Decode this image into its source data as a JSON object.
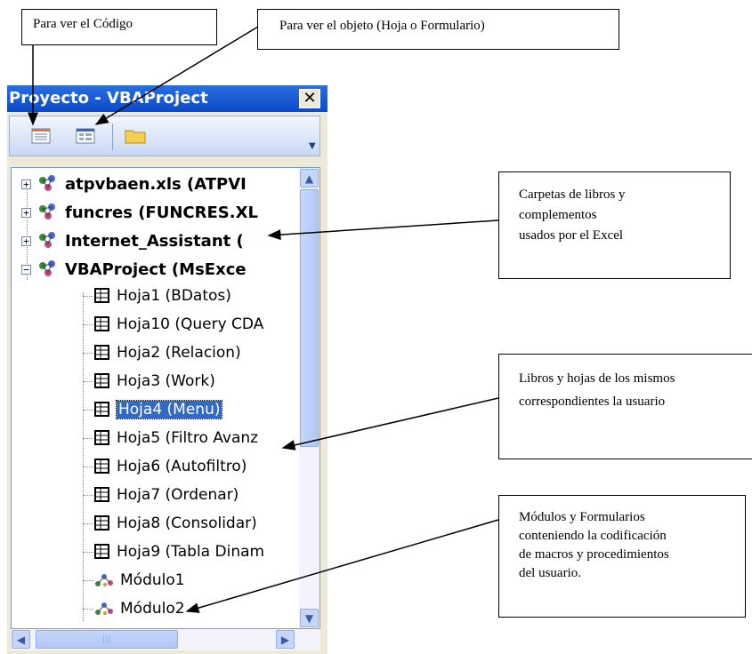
{
  "callouts": {
    "code_view": "Para ver el Código",
    "object_view": "Para ver el objeto (Hoja o Formulario)",
    "folders": [
      "Carpetas de libros y",
      "complementos",
      "usados por el Excel"
    ],
    "books": [
      "Libros y hojas de los mismos",
      "correspondientes la usuario"
    ],
    "modules": [
      "Módulos y Formularios",
      "conteniendo la codificación",
      "de macros y procedimientos",
      "del usuario."
    ]
  },
  "panel": {
    "title": "Proyecto - VBAProject",
    "close_glyph": "✕",
    "toolbar": [
      "view-code-icon",
      "view-object-icon",
      "toggle-folders-icon"
    ]
  },
  "tree": {
    "projects": [
      {
        "label": "atpvbaen.xls (ATPVI",
        "expander": "+"
      },
      {
        "label": "funcres (FUNCRES.XL",
        "expander": "+"
      },
      {
        "label": "Internet_Assistant (",
        "expander": "+"
      },
      {
        "label": "VBAProject (MsExce",
        "expander": "−"
      }
    ],
    "sheets": [
      "Hoja1 (BDatos)",
      "Hoja10 (Query CDA",
      "Hoja2 (Relacion)",
      "Hoja3 (Work)",
      "Hoja4 (Menu)",
      "Hoja5 (Filtro Avanz",
      "Hoja6 (Autofiltro)",
      "Hoja7 (Ordenar)",
      "Hoja8 (Consolidar)",
      "Hoja9 (Tabla Dinam"
    ],
    "selected_sheet": "Hoja4 (Menu)",
    "modules": [
      "Módulo1",
      "Módulo2"
    ]
  },
  "colors": {
    "titlebar": "#0a4ac9",
    "selection": "#316ac5"
  }
}
